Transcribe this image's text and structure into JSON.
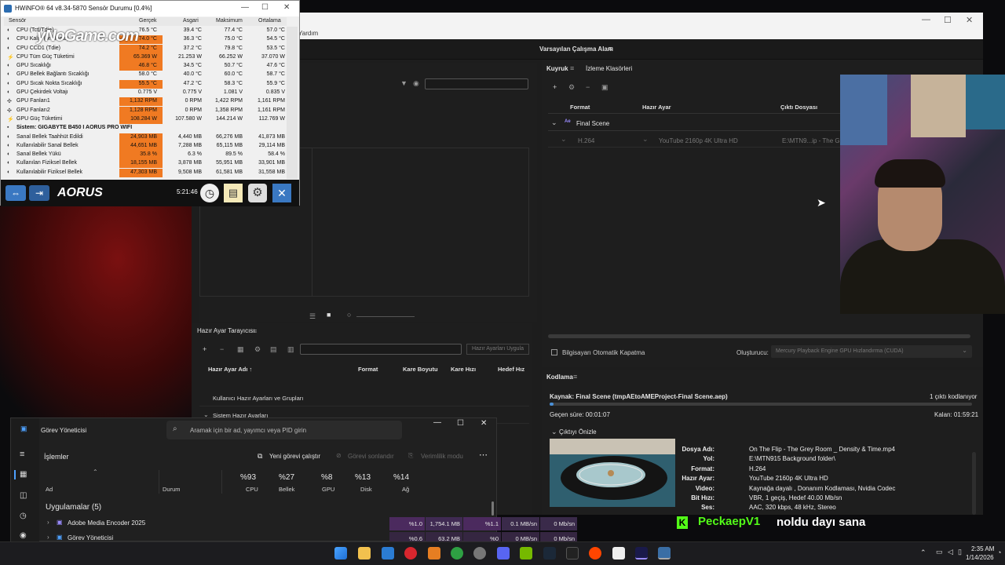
{
  "hwinfo": {
    "title": "HWiNFO® 64 v8.34-5870 Sensör Durumu [0.4%]",
    "columns": [
      "Sensör",
      "Gerçek",
      "Asgari",
      "Maksimum",
      "Ortalama"
    ],
    "rows": [
      {
        "name": "CPU (Tctl/Tdie)",
        "cur": "76.5 °C",
        "min": "39.4 °C",
        "max": "77.4 °C",
        "avg": "57.0 °C",
        "hot": false
      },
      {
        "name": "CPU Kalıp (ortalama)",
        "cur": "74.0 °C",
        "min": "36.3 °C",
        "max": "75.0 °C",
        "avg": "54.5 °C",
        "hot": true
      },
      {
        "name": "CPU CCD1 (Tdie)",
        "cur": "74.2 °C",
        "min": "37.2 °C",
        "max": "79.8 °C",
        "avg": "53.5 °C",
        "hot": true
      },
      {
        "name": "CPU Tüm Güç Tüketimi",
        "cur": "65.369 W",
        "min": "21.253 W",
        "max": "66.252 W",
        "avg": "37.070 W",
        "hot": true
      },
      {
        "name": "GPU Sıcaklığı",
        "cur": "46.8 °C",
        "min": "34.5 °C",
        "max": "50.7 °C",
        "avg": "47.6 °C",
        "hot": true
      },
      {
        "name": "GPU Bellek Bağlantı Sıcaklığı",
        "cur": "58.0 °C",
        "min": "40.0 °C",
        "max": "60.0 °C",
        "avg": "58.7 °C",
        "hot": false
      },
      {
        "name": "GPU Sıcak Nokta Sıcaklığı",
        "cur": "55.5 °C",
        "min": "47.2 °C",
        "max": "58.3 °C",
        "avg": "55.9 °C",
        "hot": true
      },
      {
        "name": "GPU Çekirdek Voltajı",
        "cur": "0.775 V",
        "min": "0.775 V",
        "max": "1.081 V",
        "avg": "0.835 V",
        "hot": false
      },
      {
        "name": "GPU Fanları1",
        "cur": "1,132 RPM",
        "min": "0 RPM",
        "max": "1,422 RPM",
        "avg": "1,161 RPM",
        "hot": true
      },
      {
        "name": "GPU Fanları2",
        "cur": "1,128 RPM",
        "min": "0 RPM",
        "max": "1,358 RPM",
        "avg": "1,161 RPM",
        "hot": true
      },
      {
        "name": "GPU Güç Tüketimi",
        "cur": "108.284 W",
        "min": "107.580 W",
        "max": "144.214 W",
        "avg": "112.769 W",
        "hot": true
      },
      {
        "name": "Sistem: GIGABYTE B450 I AORUS PRO WIFI",
        "cur": "",
        "min": "",
        "max": "",
        "avg": "",
        "hot": false,
        "section": true
      },
      {
        "name": "Sanal Bellek Taahhüt Edildi",
        "cur": "24,903 MB",
        "min": "4,440 MB",
        "max": "66,276 MB",
        "avg": "41,873 MB",
        "hot": true
      },
      {
        "name": "Kullanılabilir Sanal Bellek",
        "cur": "44,651 MB",
        "min": "7,288 MB",
        "max": "65,115 MB",
        "avg": "29,114 MB",
        "hot": true
      },
      {
        "name": "Sanal Bellek Yükü",
        "cur": "35.8 %",
        "min": "6.3 %",
        "max": "89.5 %",
        "avg": "58.4 %",
        "hot": true
      },
      {
        "name": "Kullanılan Fiziksel Bellek",
        "cur": "18,155 MB",
        "min": "3,878 MB",
        "max": "55,951 MB",
        "avg": "33,901 MB",
        "hot": true
      },
      {
        "name": "Kullanılabilir Fiziksel Bellek",
        "cur": "47,303 MB",
        "min": "9,508 MB",
        "max": "61,581 MB",
        "avg": "31,558 MB",
        "hot": true
      }
    ],
    "watermark": "yNoGame.com",
    "brand": "AORUS",
    "clock": "5:21:46"
  },
  "ame": {
    "menu_help": "Yardım",
    "workspace": "Varsayılan Çalışma Alanı",
    "queue_tab": "Kuyruk",
    "watch_tab": "İzleme Klasörleri",
    "queue_cols": {
      "format": "Format",
      "preset": "Hazır Ayar",
      "output": "Çıktı Dosyası"
    },
    "queue_group": "Final Scene",
    "queue_item": {
      "format": "H.264",
      "preset": "YouTube 2160p 4K Ultra HD",
      "output": "E:\\MTN9...ip - The Grey"
    },
    "auto_shutdown": "Bilgisayarı Otomatik Kapatma",
    "renderer_label": "Oluşturucu:",
    "renderer_value": "Mercury Playback Engine GPU Hızlandırma (CUDA)",
    "preset_browser": "Hazır Ayar Tarayıcısı",
    "apply_presets": "Hazır Ayarları Uygula",
    "preset_cols": {
      "name": "Hazır Ayar Adı ↑",
      "format": "Format",
      "frame": "Kare Boyutu",
      "rate": "Kare Hızı",
      "target": "Hedef Hız"
    },
    "preset_rows": [
      "Kullanıcı Hazır Ayarları ve Grupları",
      "Sistem Hazır Ayarları"
    ],
    "encoding_tab": "Kodlama",
    "source": "Kaynak: Final Scene (tmpAEtoAMEProject-Final Scene.aep)",
    "encoded_count": "1 çıktı kodlanıyor",
    "elapsed": "Geçen süre: 00:01:07",
    "remaining": "Kalan: 01:59:21",
    "progress": 0.01,
    "output_preview": "Çıktıyı Önizle",
    "details": [
      {
        "label": "Dosya Adı:",
        "value": "On The Flip - The Grey Room _ Density & Time.mp4"
      },
      {
        "label": "Yol:",
        "value": "E:\\MTN915 Background folder\\"
      },
      {
        "label": "Format:",
        "value": "H.264"
      },
      {
        "label": "Hazır Ayar:",
        "value": "YouTube 2160p 4K Ultra HD"
      },
      {
        "label": "Video:",
        "value": "Kaynağa dayalı , Donanım Kodlaması, Nvidia Codec"
      },
      {
        "label": "Bit Hızı:",
        "value": "VBR, 1 geçiş, Hedef 40.00 Mb/sn"
      },
      {
        "label": "Ses:",
        "value": "AAC, 320 kbps, 48 kHz, Stereo"
      }
    ]
  },
  "taskmgr": {
    "title": "Görev Yöneticisi",
    "search_placeholder": "Aramak için bir ad, yayımcı veya PID girin",
    "section": "İşlemler",
    "new_task": "Yeni görevi çalıştır",
    "end_task": "Görevi sonlandır",
    "efficiency": "Verimlilik modu",
    "col_name": "Ad",
    "col_status": "Durum",
    "cpu_pct": "%93",
    "cpu_label": "CPU",
    "mem_pct": "%27",
    "mem_label": "Bellek",
    "gpu_pct": "%8",
    "gpu_label": "GPU",
    "disk_pct": "%13",
    "disk_label": "Disk",
    "net_pct": "%14",
    "net_label": "Ağ",
    "apps_header": "Uygulamalar (5)",
    "rows": [
      {
        "name": "Adobe Media Encoder 2025",
        "cpu": "%1.0",
        "mem": "1,754.1 MB",
        "gpu": "%1.1",
        "disk": "0.1 MB/sn",
        "net": "0 Mb/sn"
      },
      {
        "name": "Görev Yöneticisi",
        "cpu": "%0.6",
        "mem": "63.2 MB",
        "gpu": "%0",
        "disk": "0 MB/sn",
        "net": "0 Mb/sn"
      }
    ]
  },
  "chat": {
    "user": "PeckaepV1",
    "message": "noldu dayı sana"
  },
  "taskbar": {
    "time": "2:35 AM",
    "date": "1/14/2026"
  }
}
